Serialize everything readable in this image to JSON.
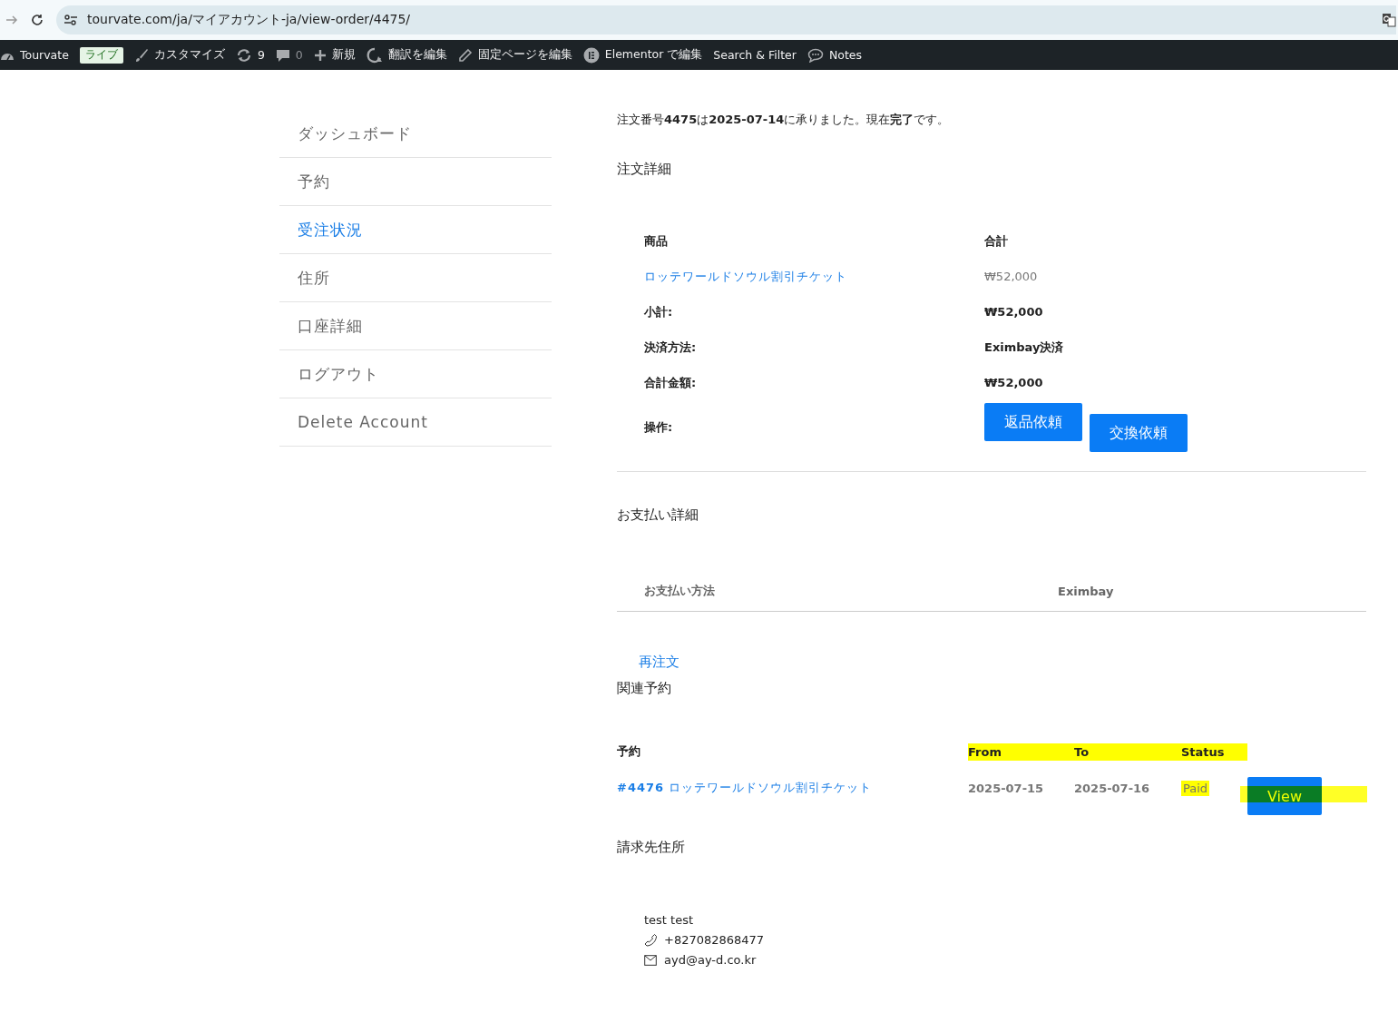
{
  "browser": {
    "url": "tourvate.com/ja/マイアカウント-ja/view-order/4475/"
  },
  "admin_bar": [
    {
      "kind": "site",
      "label": "Tourvate"
    },
    {
      "kind": "badge",
      "label": "ライブ"
    },
    {
      "kind": "customize",
      "label": "カスタマイズ"
    },
    {
      "kind": "updates",
      "label": "9"
    },
    {
      "kind": "comments",
      "label": "0"
    },
    {
      "kind": "new",
      "label": "新規"
    },
    {
      "kind": "translate",
      "label": "翻訳を編集"
    },
    {
      "kind": "edit",
      "label": "固定ページを編集"
    },
    {
      "kind": "elementor",
      "label": "Elementor で編集"
    },
    {
      "kind": "plain",
      "label": "Search & Filter"
    },
    {
      "kind": "notes",
      "label": "Notes"
    }
  ],
  "sidebar": {
    "items": [
      {
        "label": "ダッシュボード",
        "selected": false
      },
      {
        "label": "予約",
        "selected": false
      },
      {
        "label": "受注状況",
        "selected": true
      },
      {
        "label": "住所",
        "selected": false
      },
      {
        "label": "口座詳細",
        "selected": false
      },
      {
        "label": "ログアウト",
        "selected": false
      },
      {
        "label": "Delete Account",
        "selected": false
      }
    ]
  },
  "notice": "注文番号**4475**は**2025-07-14**に承りました。現在**完了**です。",
  "order_details": {
    "title": "注文詳細",
    "columns": [
      "商品",
      "合計"
    ],
    "product": {
      "name": "ロッテワールドソウル割引チケット",
      "total": "₩52,000"
    },
    "rows": [
      {
        "label": "小計:",
        "value": "₩52,000"
      },
      {
        "label": "決済方法:",
        "value": "Eximbay決済"
      },
      {
        "label": "合計金額:",
        "value": "₩52,000"
      }
    ],
    "actions_label": "操作:",
    "actions": [
      "返品依頼",
      "交換依頼"
    ]
  },
  "payment_details": {
    "title": "お支払い詳細",
    "label": "お支払い方法",
    "value": "Eximbay"
  },
  "reorder_link": "再注文",
  "related": {
    "title": "関連予約",
    "columns": [
      {
        "label": "予約",
        "highlighted": false
      },
      {
        "label": "From",
        "highlighted": true
      },
      {
        "label": "To",
        "highlighted": true
      },
      {
        "label": "Status",
        "highlighted": true
      }
    ],
    "rows": [
      {
        "id": "#4476",
        "name": "ロッテワールドソウル割引チケット",
        "from": "2025-07-15",
        "to": "2025-07-16",
        "status": "Paid",
        "status_highlighted": true,
        "button": "View",
        "button_highlighted": true
      }
    ]
  },
  "billing": {
    "title": "請求先住所",
    "name": "test test",
    "phone": "+827082868477",
    "email": "ayd@ay-d.co.kr"
  }
}
